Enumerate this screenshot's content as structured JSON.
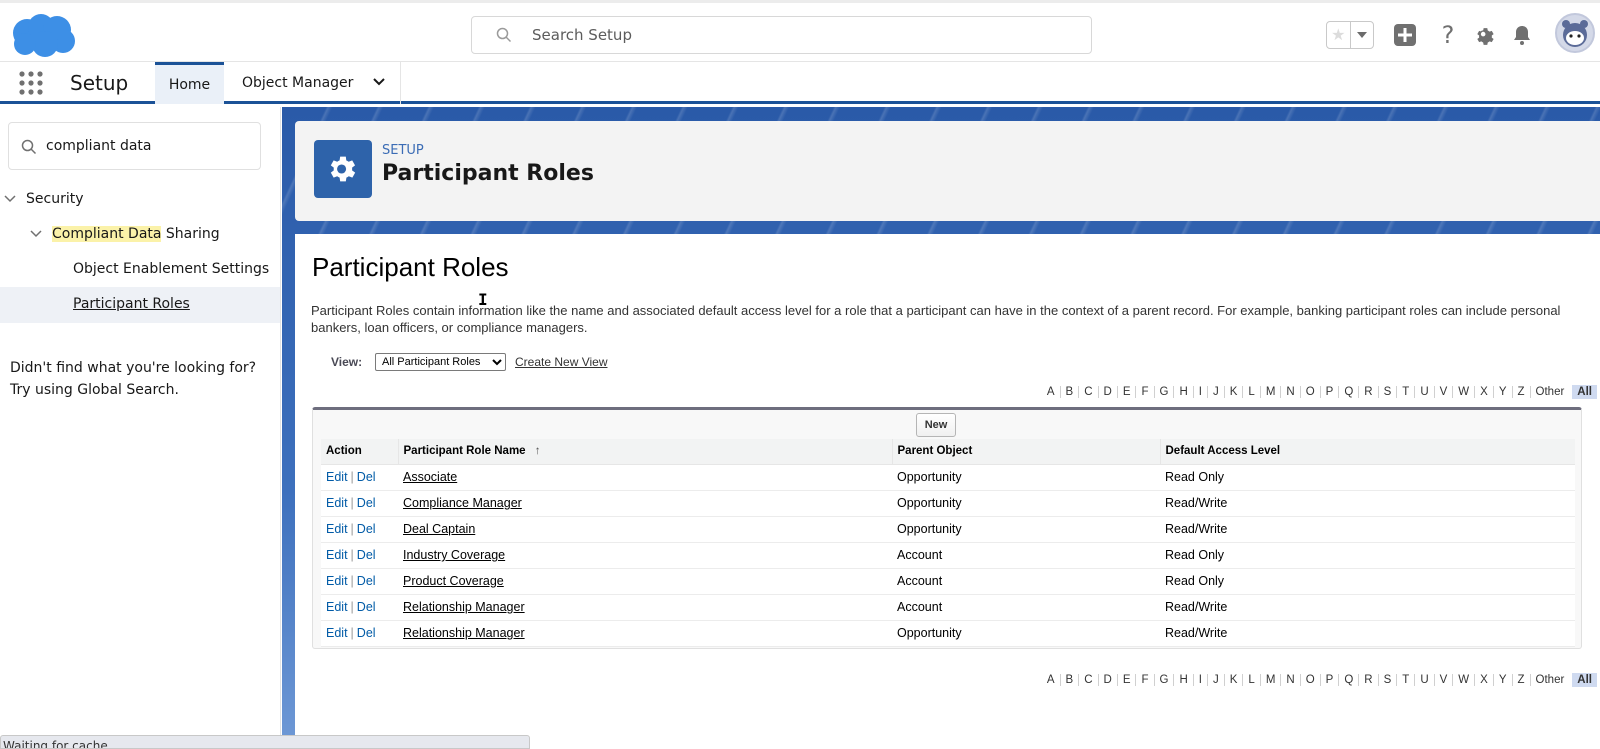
{
  "global_header": {
    "logo": "salesforce-cloud-logo",
    "search_placeholder": "Search Setup",
    "icons": [
      "favorites-star-icon",
      "favorites-dropdown-icon",
      "global-actions-add-icon",
      "help-icon",
      "setup-gear-icon",
      "notifications-bell-icon",
      "user-avatar"
    ]
  },
  "context_nav": {
    "app_name": "Setup",
    "tabs": [
      {
        "label": "Home",
        "active": true
      },
      {
        "label": "Object Manager",
        "active": false,
        "has_dropdown": true
      }
    ]
  },
  "sidebar": {
    "quick_find_value": "compliant data",
    "tree": [
      {
        "label": "Security",
        "expanded": true,
        "level": 0
      },
      {
        "label_highlight": "Compliant Data",
        "label_rest": " Sharing",
        "expanded": true,
        "level": 1
      },
      {
        "label": "Object Enablement Settings",
        "level": 2
      },
      {
        "label": "Participant Roles",
        "level": 2,
        "selected": true
      }
    ],
    "help_line1": "Didn't find what you're looking for?",
    "help_line2": "Try using Global Search."
  },
  "page_header": {
    "eyebrow": "SETUP",
    "title": "Participant Roles",
    "icon": "gear-icon"
  },
  "content": {
    "title": "Participant Roles",
    "description": "Participant Roles contain information like the name and associated default access level for a role that a participant can have in the context of a parent record. For example, banking participant roles can include personal bankers, loan officers, or compliance managers.",
    "view_label": "View:",
    "view_selected": "All Participant Roles",
    "create_view_link": "Create New View",
    "alpha_letters": [
      "A",
      "B",
      "C",
      "D",
      "E",
      "F",
      "G",
      "H",
      "I",
      "J",
      "K",
      "L",
      "M",
      "N",
      "O",
      "P",
      "Q",
      "R",
      "S",
      "T",
      "U",
      "V",
      "W",
      "X",
      "Y",
      "Z",
      "Other"
    ],
    "alpha_all": "All",
    "new_button": "New",
    "table": {
      "columns": [
        "Action",
        "Participant Role Name",
        "Parent Object",
        "Default Access Level"
      ],
      "sort_indicator": "↑",
      "edit_label": "Edit",
      "del_label": "Del",
      "rows": [
        {
          "name": "Associate",
          "parent": "Opportunity",
          "access": "Read Only"
        },
        {
          "name": "Compliance Manager",
          "parent": "Opportunity",
          "access": "Read/Write"
        },
        {
          "name": "Deal Captain",
          "parent": "Opportunity",
          "access": "Read/Write"
        },
        {
          "name": "Industry Coverage",
          "parent": "Account",
          "access": "Read Only"
        },
        {
          "name": "Product Coverage",
          "parent": "Account",
          "access": "Read Only"
        },
        {
          "name": "Relationship Manager",
          "parent": "Account",
          "access": "Read/Write"
        },
        {
          "name": "Relationship Manager",
          "parent": "Opportunity",
          "access": "Read/Write"
        }
      ]
    }
  },
  "status_bar": {
    "text": "Waiting for cache..."
  },
  "colors": {
    "brand_blue": "#1b5297",
    "link_blue": "#015ba7",
    "highlight_yellow": "#fbf2a9",
    "header_icon_bg": "#2e63aa"
  }
}
